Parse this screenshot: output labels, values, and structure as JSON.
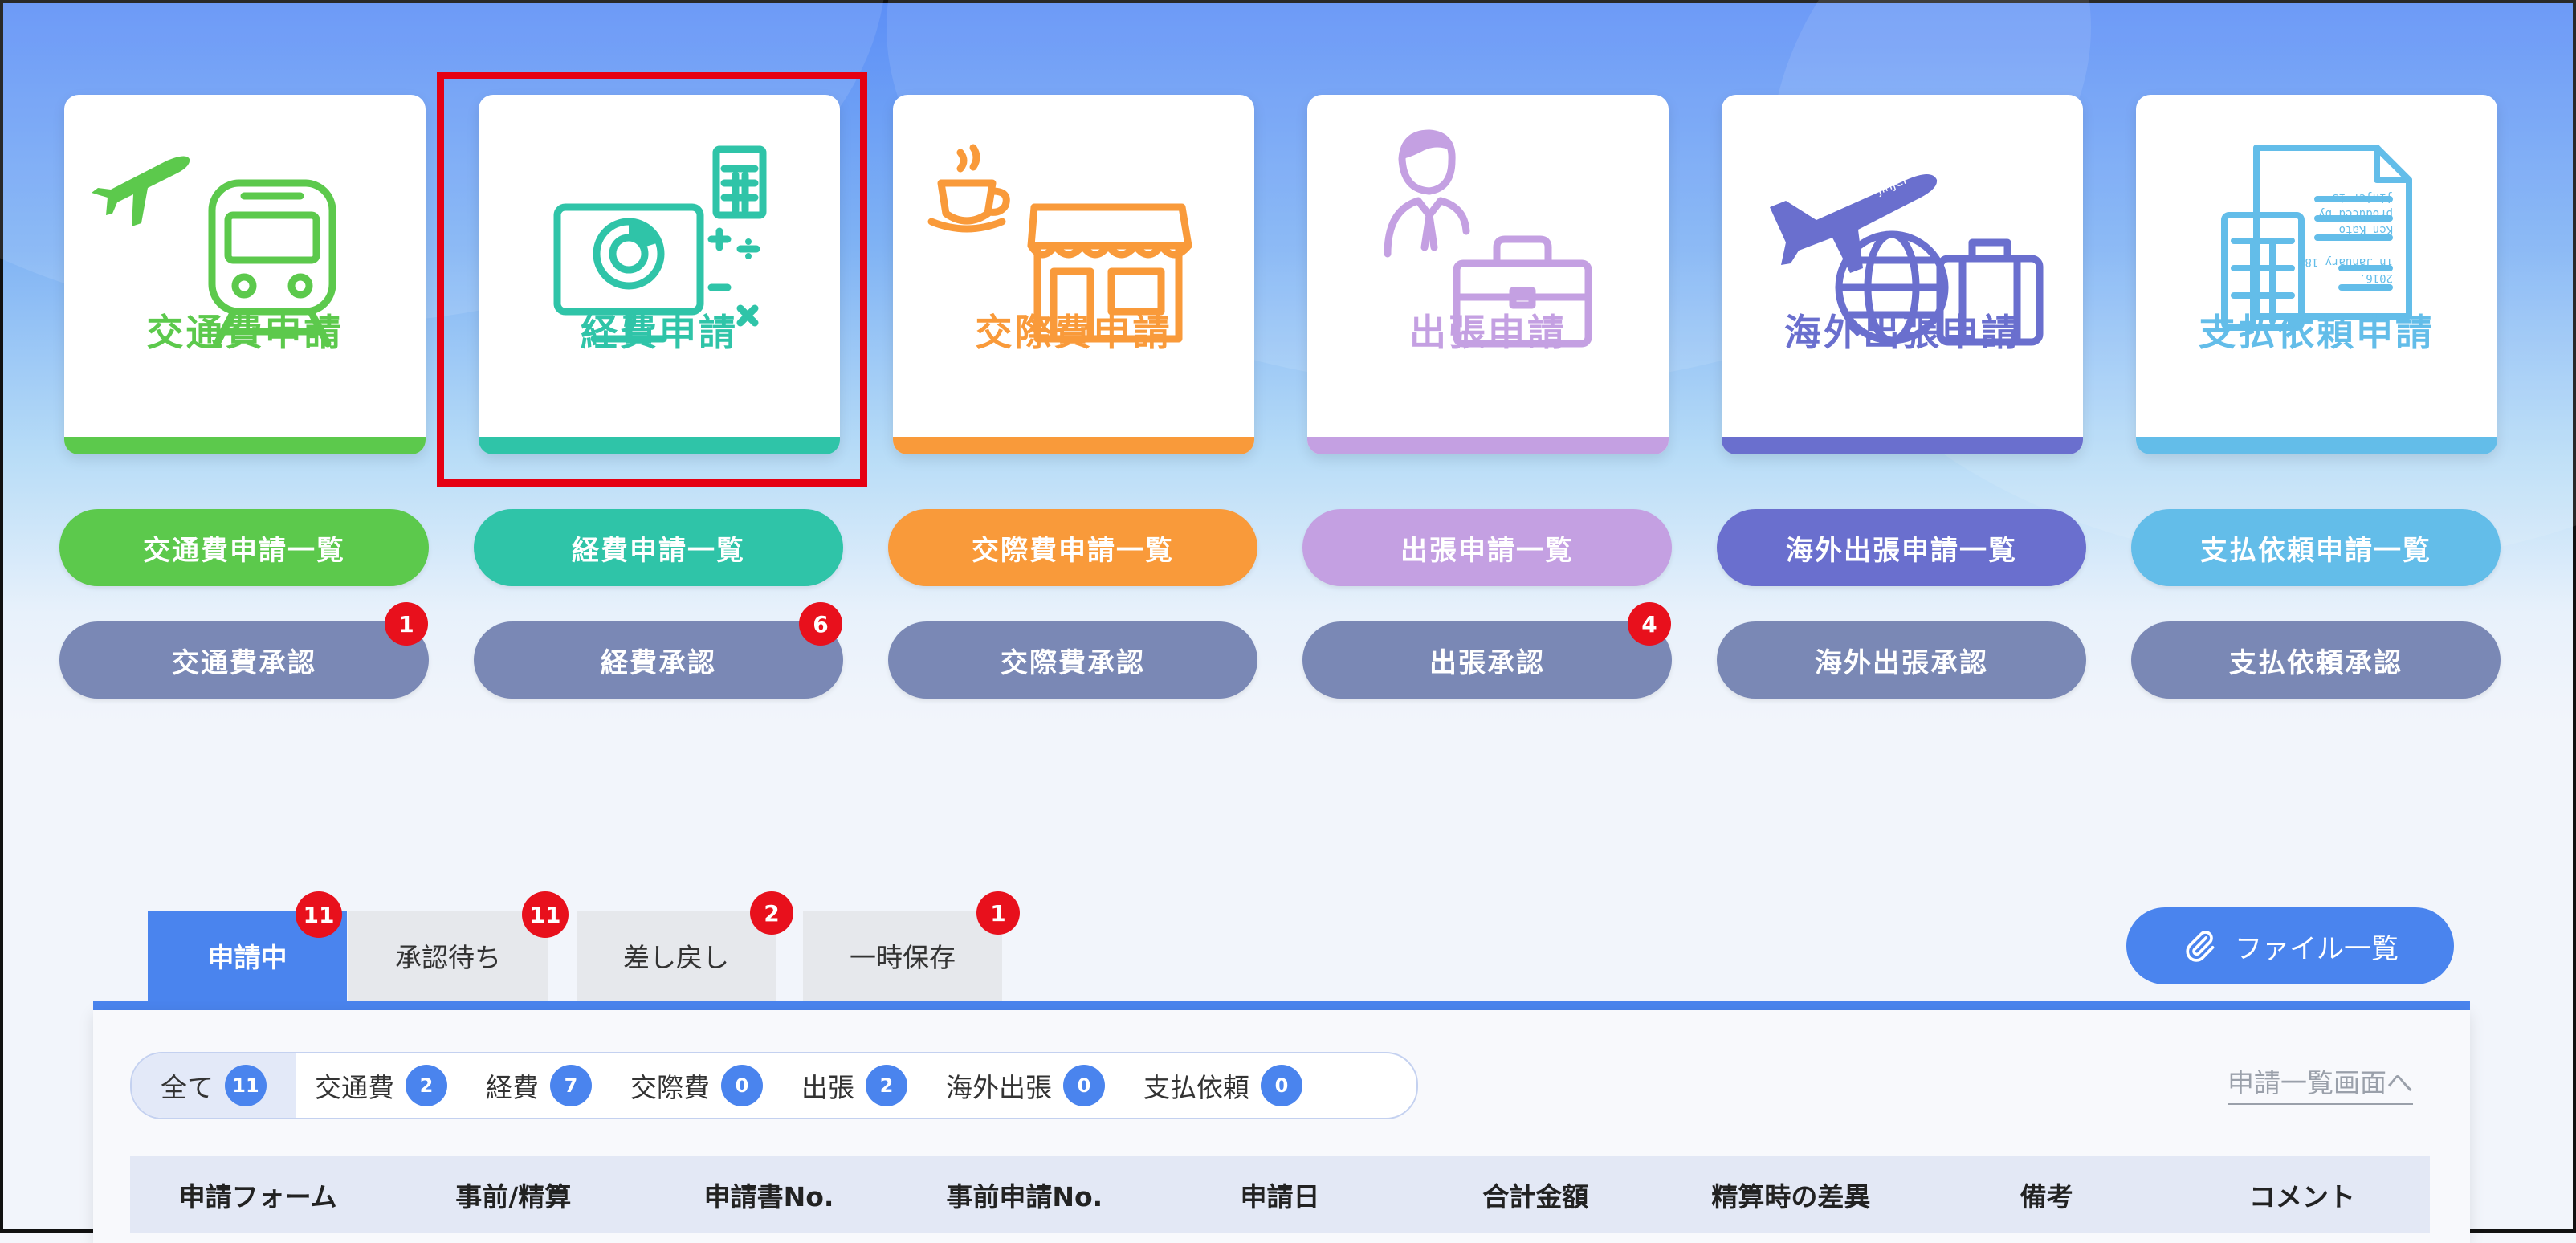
{
  "cards": [
    {
      "title": "交通費申請",
      "color": "#5cc94c",
      "icon": "airplane-train-icon"
    },
    {
      "title": "経費申請",
      "color": "#2fc4a8",
      "icon": "monitor-calculator-icon"
    },
    {
      "title": "交際費申請",
      "color": "#f99a3a",
      "icon": "coffee-shop-icon"
    },
    {
      "title": "出張申請",
      "color": "#c4a0e2",
      "icon": "businessman-briefcase-icon"
    },
    {
      "title": "海外出張申請",
      "color": "#6a6fce",
      "icon": "plane-globe-suitcase-icon"
    },
    {
      "title": "支払依頼申請",
      "color": "#63bde9",
      "icon": "calculator-invoice-icon"
    }
  ],
  "list_buttons": [
    "交通費申請一覧",
    "経費申請一覧",
    "交際費申請一覧",
    "出張申請一覧",
    "海外出張申請一覧",
    "支払依頼申請一覧"
  ],
  "approve_buttons": [
    "交通費承認",
    "経費承認",
    "交際費承認",
    "出張承認",
    "海外出張承認",
    "支払依頼承認"
  ],
  "approve_badges": {
    "0": "1",
    "1": "6",
    "3": "4"
  },
  "airplane_text": "jinjer",
  "document_text": [
    "jinjer is",
    "produced by",
    "Ken Kato",
    "in January 18,",
    "2016."
  ],
  "tabs": [
    {
      "label": "申請中",
      "badge": "11"
    },
    {
      "label": "承認待ち",
      "badge": "11"
    },
    {
      "label": "差し戻し",
      "badge": "2"
    },
    {
      "label": "一時保存",
      "badge": "1"
    }
  ],
  "file_button": "ファイル一覧",
  "filters": [
    {
      "label": "全て",
      "count": "11"
    },
    {
      "label": "交通費",
      "count": "2"
    },
    {
      "label": "経費",
      "count": "7"
    },
    {
      "label": "交際費",
      "count": "0"
    },
    {
      "label": "出張",
      "count": "2"
    },
    {
      "label": "海外出張",
      "count": "0"
    },
    {
      "label": "支払依頼",
      "count": "0"
    }
  ],
  "list_link": "申請一覧画面へ",
  "columns": [
    "申請フォーム",
    "事前/精算",
    "申請書No.",
    "事前申請No.",
    "申請日",
    "合計金額",
    "精算時の差異",
    "備考",
    "コメント"
  ]
}
